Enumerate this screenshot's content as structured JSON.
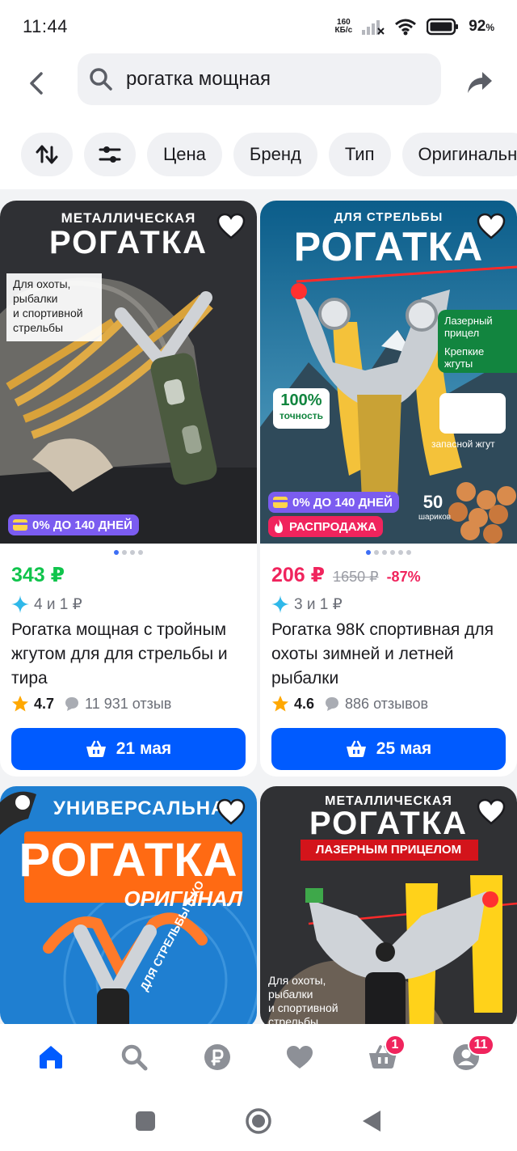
{
  "status_bar": {
    "time": "11:44",
    "net_speed_value": "160",
    "net_speed_unit": "КБ/с",
    "battery": "92",
    "battery_unit": "%"
  },
  "header": {
    "search_value": "рогатка мощная"
  },
  "filters": {
    "chips": [
      "Цена",
      "Бренд",
      "Тип",
      "Оригинальн"
    ]
  },
  "products": [
    {
      "img_top": "МЕТАЛЛИЧЕСКАЯ",
      "img_main": "РОГАТКА",
      "img_note": "Для охоты,\nрыбалки\nи спортивной\nстрельбы",
      "installment": "0% ДО 140 ДНЕЙ",
      "price": "343 ₽",
      "bonus": "4 и 1 ₽",
      "title": "Рогатка мощная с тройным жгутом для для стрельбы и тира",
      "rating": "4.7",
      "reviews": "11 931 отзыв",
      "delivery": "21 мая"
    },
    {
      "img_top": "ДЛЯ СТРЕЛЬБЫ",
      "img_main": "РОГАТКА",
      "feature_1": "Лазерный прицел",
      "feature_2": "Крепкие жгуты",
      "accuracy_value": "100%",
      "accuracy_label": "точность",
      "spare_label": "запасной жгут",
      "balls_value": "50",
      "balls_label": "шариков",
      "installment": "0% ДО 140 ДНЕЙ",
      "sale": "РАСПРОДАЖА",
      "price": "206 ₽",
      "price_old": "1650 ₽",
      "discount": "-87%",
      "bonus": "3 и 1 ₽",
      "title": "Рогатка 98К спортивная для охоты зимней и летней рыбалки",
      "rating": "4.6",
      "reviews": "886 отзывов",
      "delivery": "25 мая"
    },
    {
      "img_top": "УНИВЕРСАЛЬНАЯ",
      "img_main": "РОГАТКА",
      "img_sub": "ОРИГИНАЛ",
      "img_side": "ДЛЯ СТРЕЛЬБЫ В КО"
    },
    {
      "img_top": "МЕТАЛЛИЧЕСКАЯ",
      "img_main": "РОГАТКА",
      "img_sub": "ЛАЗЕРНЫМ ПРИЦЕЛОМ",
      "img_note": "Для охоты,\nрыбалки\nи спортивной\nстрельбы"
    }
  ],
  "bottom_nav": {
    "cart_badge": "1",
    "profile_badge": "11"
  },
  "colors": {
    "accent": "#005bff",
    "price_green": "#10c44c",
    "price_pink": "#f0245d",
    "installment": "#7b5cf0",
    "sale": "#f0245d"
  }
}
